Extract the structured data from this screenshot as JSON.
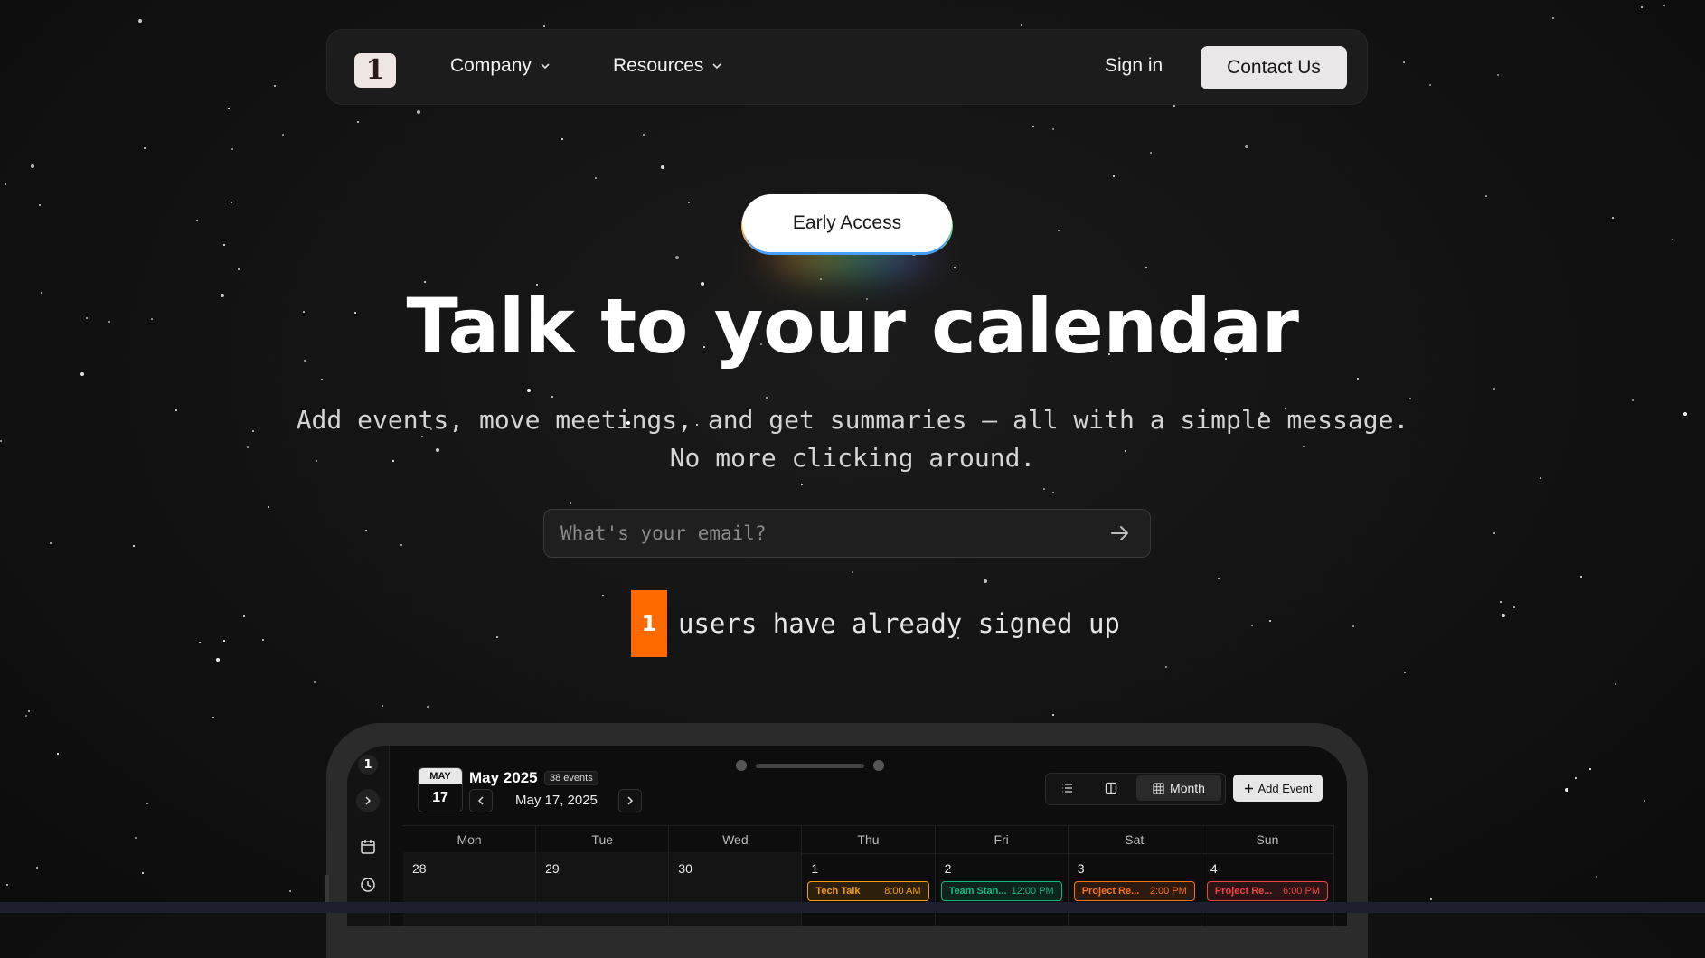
{
  "nav": {
    "logo_text": "1",
    "company_label": "Company",
    "resources_label": "Resources",
    "signin_label": "Sign in",
    "contact_label": "Contact Us"
  },
  "hero": {
    "badge_label": "Early Access",
    "headline": "Talk to your calendar",
    "subtitle_line1": "Add events, move meetings, and get summaries — all with a simple message.",
    "subtitle_line2": "No more clicking around.",
    "email_placeholder": "What's your email?",
    "signup_count": "1",
    "signup_text": "users have already signed up"
  },
  "calendar": {
    "rail_logo": "1",
    "badge_month": "MAY",
    "badge_day": "17",
    "month_title": "May 2025",
    "events_count": "38 events",
    "current_date": "May 17, 2025",
    "view_month_label": "Month",
    "add_event_label": "Add Event",
    "weekdays": [
      "Mon",
      "Tue",
      "Wed",
      "Thu",
      "Fri",
      "Sat",
      "Sun"
    ],
    "days": [
      {
        "num": "28",
        "prev": true
      },
      {
        "num": "29",
        "prev": true
      },
      {
        "num": "30",
        "prev": true
      },
      {
        "num": "1",
        "prev": false,
        "event": {
          "title": "Tech Talk",
          "time": "8:00 AM",
          "color": "#f59e0b"
        }
      },
      {
        "num": "2",
        "prev": false,
        "event": {
          "title": "Team Stan...",
          "time": "12:00 PM",
          "color": "#10b981"
        }
      },
      {
        "num": "3",
        "prev": false,
        "event": {
          "title": "Project Re...",
          "time": "2:00 PM",
          "color": "#f97316"
        }
      },
      {
        "num": "4",
        "prev": false,
        "event": {
          "title": "Project Re...",
          "time": "6:00 PM",
          "color": "#ef4444"
        }
      }
    ]
  },
  "colors": {
    "accent_orange": "#ff6a00",
    "background": "#121212"
  }
}
